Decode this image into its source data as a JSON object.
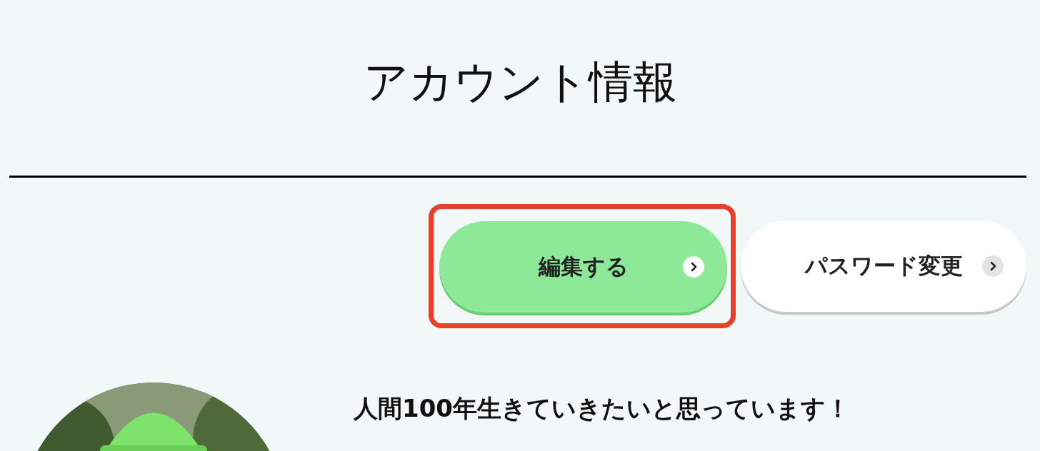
{
  "title": "アカウント情報",
  "buttons": [
    {
      "label": "編集する",
      "kind": "primary",
      "highlighted": true
    },
    {
      "label": "パスワード変更",
      "kind": "secondary",
      "highlighted": false
    }
  ],
  "profile": {
    "headline": "人間100年生きていきたいと思っています！"
  }
}
